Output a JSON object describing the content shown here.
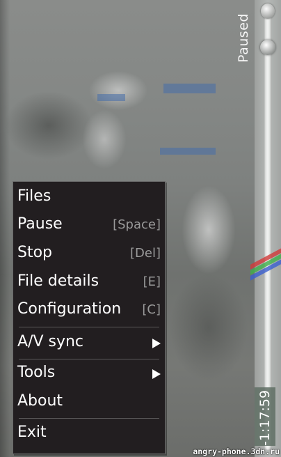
{
  "player": {
    "status": "Paused",
    "time_remaining": "-1:17:59"
  },
  "menu": {
    "items": [
      {
        "label": "Files",
        "shortcut": ""
      },
      {
        "label": "Pause",
        "shortcut": "[Space]"
      },
      {
        "label": "Stop",
        "shortcut": "[Del]"
      },
      {
        "label": "File details",
        "shortcut": "[E]"
      },
      {
        "label": "Configuration",
        "shortcut": "[C]"
      },
      {
        "label": "A/V sync",
        "submenu": true,
        "icon": "chevron-right-icon"
      },
      {
        "label": "Tools",
        "submenu": true,
        "icon": "chevron-right-icon"
      },
      {
        "label": "About",
        "shortcut": ""
      },
      {
        "label": "Exit",
        "shortcut": ""
      }
    ]
  },
  "watermark": "angry-phone.3dn.ru",
  "colors": {
    "menu_background": "#221e20",
    "menu_text": "#ffffff",
    "shortcut_text": "#9a9a9a",
    "time_box": "#5f6e64"
  }
}
